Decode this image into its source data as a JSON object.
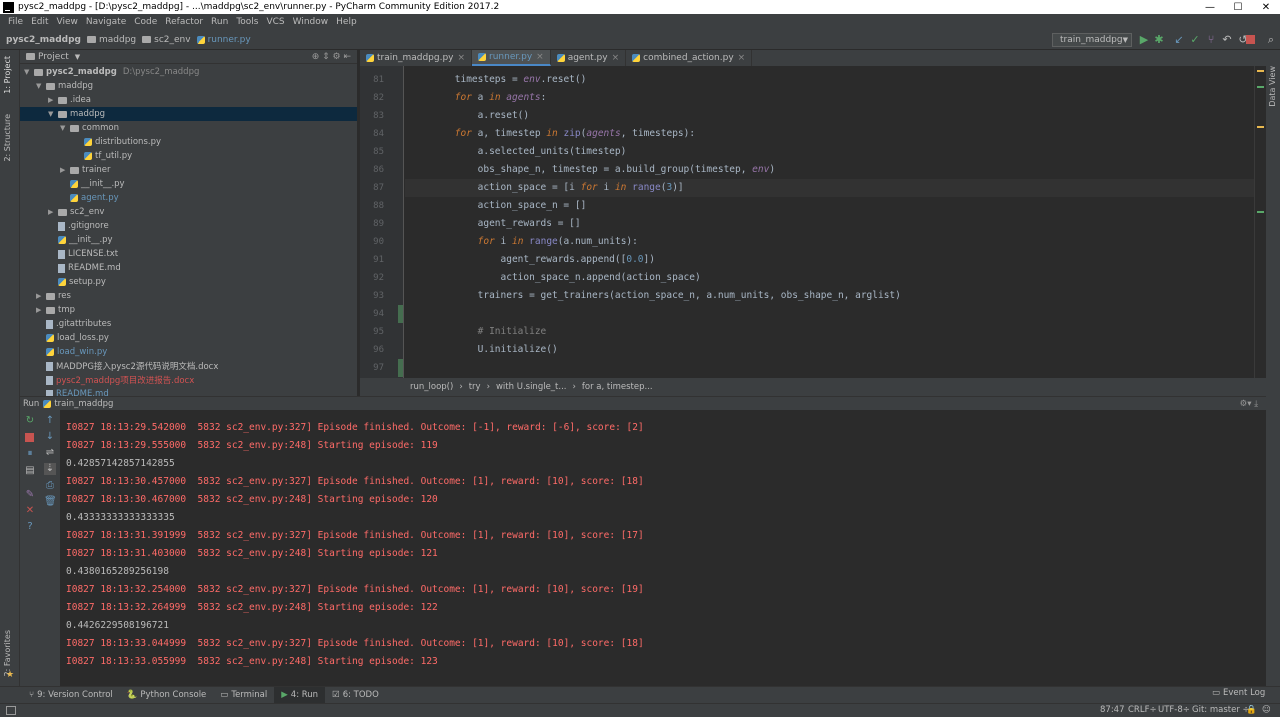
{
  "window": {
    "title": "pysc2_maddpg - [D:\\pysc2_maddpg] - ...\\maddpg\\sc2_env\\runner.py - PyCharm Community Edition 2017.2",
    "minimize": "—",
    "maximize": "☐",
    "close": "✕"
  },
  "menu": [
    "File",
    "Edit",
    "View",
    "Navigate",
    "Code",
    "Refactor",
    "Run",
    "Tools",
    "VCS",
    "Window",
    "Help"
  ],
  "nav": {
    "crumbs": [
      "pysc2_maddpg",
      "maddpg",
      "sc2_env",
      "runner.py"
    ],
    "run_config": "train_maddpg"
  },
  "lefttool": {
    "project": "1: Project",
    "structure": "2: Structure",
    "favorites": "2: Favorites"
  },
  "righttool": {
    "dataview": "Data View"
  },
  "project": {
    "header": "Project",
    "tree": [
      {
        "label": "pysc2_maddpg",
        "extra": "D:\\pysc2_maddpg",
        "arrow": "▼",
        "type": "folder",
        "bold": true
      },
      {
        "label": "maddpg",
        "arrow": "▼",
        "type": "folder"
      },
      {
        "label": ".idea",
        "arrow": "▶",
        "type": "folder"
      },
      {
        "label": "maddpg",
        "arrow": "▼",
        "type": "folder",
        "selected": true
      },
      {
        "label": "common",
        "arrow": "▼",
        "type": "folder"
      },
      {
        "label": "distributions.py",
        "arrow": "",
        "type": "py"
      },
      {
        "label": "tf_util.py",
        "arrow": "",
        "type": "py"
      },
      {
        "label": "trainer",
        "arrow": "▶",
        "type": "folder"
      },
      {
        "label": "__init__.py",
        "arrow": "",
        "type": "py"
      },
      {
        "label": "agent.py",
        "arrow": "",
        "type": "py",
        "color": "#6897bb"
      },
      {
        "label": "sc2_env",
        "arrow": "▶",
        "type": "folder"
      },
      {
        "label": ".gitignore",
        "arrow": "",
        "type": "file"
      },
      {
        "label": "__init__.py",
        "arrow": "",
        "type": "py"
      },
      {
        "label": "LICENSE.txt",
        "arrow": "",
        "type": "file"
      },
      {
        "label": "README.md",
        "arrow": "",
        "type": "file"
      },
      {
        "label": "setup.py",
        "arrow": "",
        "type": "py"
      },
      {
        "label": "res",
        "arrow": "▶",
        "type": "folder"
      },
      {
        "label": "tmp",
        "arrow": "▶",
        "type": "folder"
      },
      {
        "label": ".gitattributes",
        "arrow": "",
        "type": "file"
      },
      {
        "label": "load_loss.py",
        "arrow": "",
        "type": "py"
      },
      {
        "label": "load_win.py",
        "arrow": "",
        "type": "py",
        "color": "#6897bb"
      },
      {
        "label": "MADDPG接入pysc2源代码说明文档.docx",
        "arrow": "",
        "type": "file"
      },
      {
        "label": "pysc2_maddpg项目改进报告.docx",
        "arrow": "",
        "type": "file",
        "color": "#d25252"
      },
      {
        "label": "README.md",
        "arrow": "",
        "type": "file",
        "color": "#6897bb"
      }
    ]
  },
  "tabs": [
    {
      "label": "train_maddpg.py",
      "close": "×"
    },
    {
      "label": "runner.py",
      "close": "×",
      "active": true
    },
    {
      "label": "agent.py",
      "close": "×"
    },
    {
      "label": "combined_action.py",
      "close": "×"
    }
  ],
  "code": {
    "current_line": 87,
    "lines": [
      {
        "n": "81",
        "html": "        timesteps = <span class='it'>env</span>.reset()"
      },
      {
        "n": "82",
        "html": "        <span class='kw'>for</span> a <span class='kw'>in</span> <span class='it'>agents</span>:"
      },
      {
        "n": "83",
        "html": "            a.reset()"
      },
      {
        "n": "84",
        "html": "        <span class='kw'>for</span> a, timestep <span class='kw'>in</span> <span class='bi'>zip</span>(<span class='it'>agents</span>, timesteps):"
      },
      {
        "n": "85",
        "html": "            a.selected_units(timestep)"
      },
      {
        "n": "86",
        "html": "            obs_shape_n, timestep = a.build_group(timestep, <span class='it'>env</span>)"
      },
      {
        "n": "87",
        "html": "            action_space = [i <span class='kw'>for</span> i <span class='kw'>in</span> <span class='bi'>range</span>(<span class='num'>3</span>)]"
      },
      {
        "n": "88",
        "html": "            action_space_n = []"
      },
      {
        "n": "89",
        "html": "            agent_rewards = []"
      },
      {
        "n": "90",
        "html": "            <span class='kw'>for</span> i <span class='kw'>in</span> <span class='bi'>range</span>(a.num_units):"
      },
      {
        "n": "91",
        "html": "                agent_rewards.append([<span class='num'>0.0</span>])"
      },
      {
        "n": "92",
        "html": "                action_space_n.append(action_space)"
      },
      {
        "n": "93",
        "html": "            trainers = get_trainers(action_space_n, a.num_units, obs_shape_n, arglist)"
      },
      {
        "n": "94",
        "html": ""
      },
      {
        "n": "95",
        "html": "            <span class='cmt'># Initialize</span>"
      },
      {
        "n": "96",
        "html": "            U.initialize()"
      },
      {
        "n": "97",
        "html": ""
      }
    ]
  },
  "code_breadcrumb": [
    "run_loop()",
    "›",
    "try",
    "›",
    "with U.single_t...",
    "›",
    "for a, timestep..."
  ],
  "run": {
    "label": "Run",
    "config": "train_maddpg",
    "lines": [
      {
        "t": "log",
        "text": "I0827 18:13:29.542000  5832 sc2_env.py:327] Episode finished. Outcome: [-1], reward: [-6], score: [2]"
      },
      {
        "t": "log",
        "text": "I0827 18:13:29.555000  5832 sc2_env.py:248] Starting episode: 119"
      },
      {
        "t": "out",
        "text": "0.42857142857142855"
      },
      {
        "t": "log",
        "text": "I0827 18:13:30.457000  5832 sc2_env.py:327] Episode finished. Outcome: [1], reward: [10], score: [18]"
      },
      {
        "t": "log",
        "text": "I0827 18:13:30.467000  5832 sc2_env.py:248] Starting episode: 120"
      },
      {
        "t": "out",
        "text": "0.43333333333333335"
      },
      {
        "t": "log",
        "text": "I0827 18:13:31.391999  5832 sc2_env.py:327] Episode finished. Outcome: [1], reward: [10], score: [17]"
      },
      {
        "t": "log",
        "text": "I0827 18:13:31.403000  5832 sc2_env.py:248] Starting episode: 121"
      },
      {
        "t": "out",
        "text": "0.4380165289256198"
      },
      {
        "t": "log",
        "text": "I0827 18:13:32.254000  5832 sc2_env.py:327] Episode finished. Outcome: [1], reward: [10], score: [19]"
      },
      {
        "t": "log",
        "text": "I0827 18:13:32.264999  5832 sc2_env.py:248] Starting episode: 122"
      },
      {
        "t": "out",
        "text": "0.4426229508196721"
      },
      {
        "t": "log",
        "text": "I0827 18:13:33.044999  5832 sc2_env.py:327] Episode finished. Outcome: [1], reward: [10], score: [18]"
      },
      {
        "t": "log",
        "text": "I0827 18:13:33.055999  5832 sc2_env.py:248] Starting episode: 123"
      }
    ]
  },
  "bottom_tabs": [
    {
      "label": "9: Version Control",
      "icon": "version-control-icon"
    },
    {
      "label": "Python Console",
      "icon": "python-console-icon"
    },
    {
      "label": "Terminal",
      "icon": "terminal-icon"
    },
    {
      "label": "4: Run",
      "icon": "run-icon",
      "active": true
    },
    {
      "label": "6: TODO",
      "icon": "todo-icon"
    }
  ],
  "event_log": "Event Log",
  "status": {
    "position": "87:47",
    "line_sep": "CRLF÷",
    "encoding": "UTF-8÷",
    "git": "Git: master ÷"
  },
  "colors": {
    "accent": "#4a88c7",
    "error_text": "#ff6b68",
    "run_green": "#59a869"
  }
}
